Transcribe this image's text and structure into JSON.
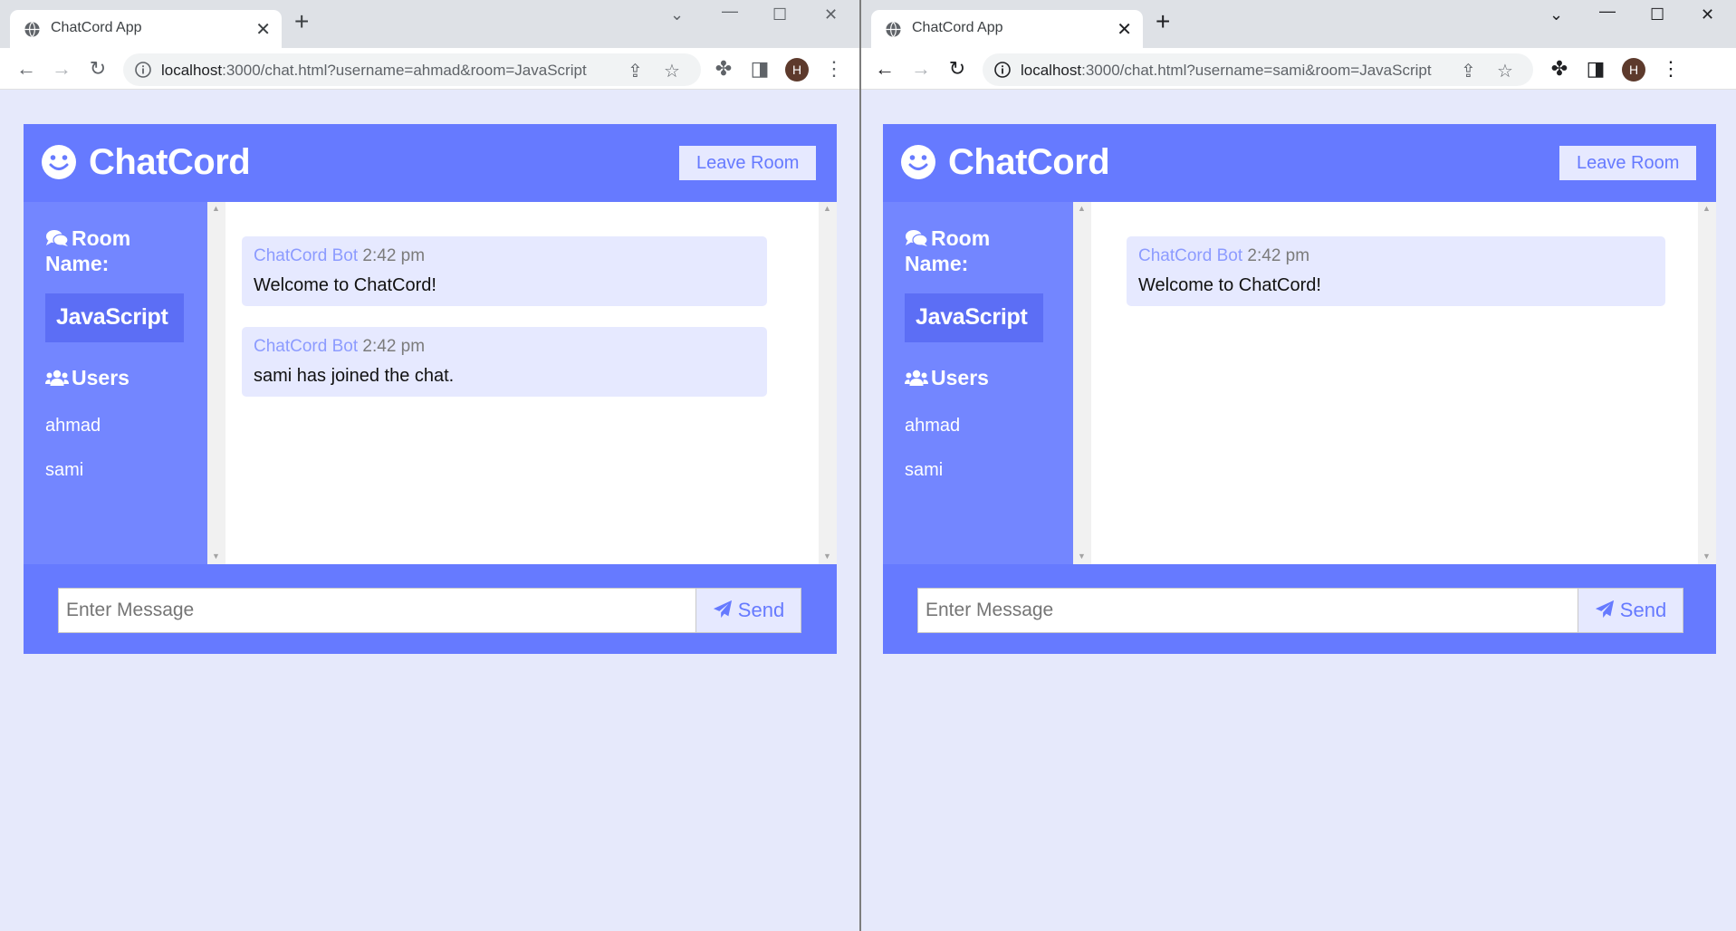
{
  "windows": [
    {
      "tab_title": "ChatCord App",
      "url_host": "localhost",
      "url_rest": ":3000/chat.html?username=ahmad&room=JavaScript",
      "avatar_letter": "H",
      "brand": "ChatCord",
      "leave_label": "Leave Room",
      "room_heading_line1": "Room",
      "room_heading_line2": "Name:",
      "room_name": "JavaScript",
      "users_heading": "Users",
      "users": [
        "ahmad",
        "sami"
      ],
      "messages": [
        {
          "user": "ChatCord Bot",
          "time": "2:42 pm",
          "text": "Welcome to ChatCord!"
        },
        {
          "user": "ChatCord Bot",
          "time": "2:42 pm",
          "text": "sami has joined the chat."
        }
      ],
      "input_placeholder": "Enter Message",
      "send_label": "Send"
    },
    {
      "tab_title": "ChatCord App",
      "url_host": "localhost",
      "url_rest": ":3000/chat.html?username=sami&room=JavaScript",
      "avatar_letter": "H",
      "brand": "ChatCord",
      "leave_label": "Leave Room",
      "room_heading_line1": "Room",
      "room_heading_line2": "Name:",
      "room_name": "JavaScript",
      "users_heading": "Users",
      "users": [
        "ahmad",
        "sami"
      ],
      "messages": [
        {
          "user": "ChatCord Bot",
          "time": "2:42 pm",
          "text": "Welcome to ChatCord!"
        }
      ],
      "input_placeholder": "Enter Message",
      "send_label": "Send"
    }
  ],
  "colors": {
    "primary": "#667aff",
    "sidebar": "#7386ff",
    "room_badge": "#5c6ef5",
    "light": "#e6e9ff",
    "page_bg": "#e6e9fb",
    "bot_name": "#8c9bff"
  },
  "icons": {
    "favicon": "globe-icon",
    "brand": "smile-icon",
    "room": "comments-icon",
    "users": "users-icon",
    "send": "paper-plane-icon"
  }
}
